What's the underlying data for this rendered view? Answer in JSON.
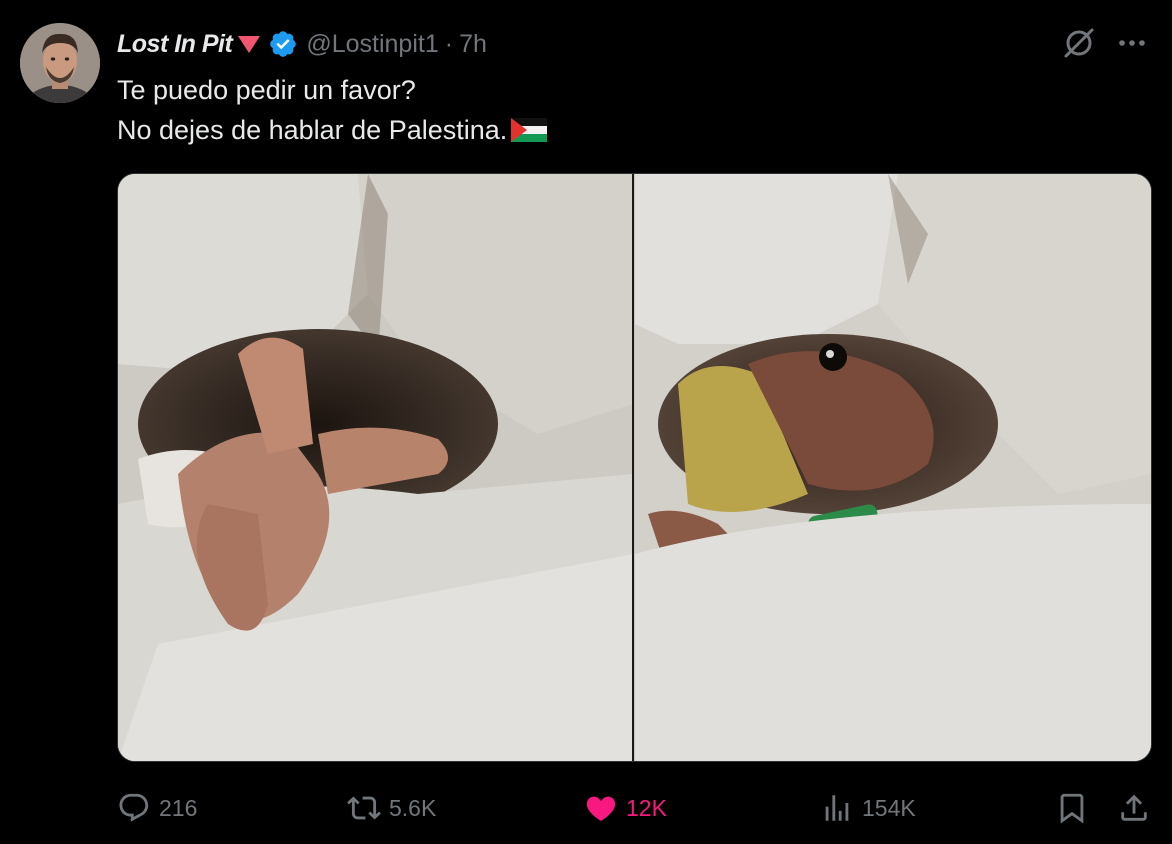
{
  "tweet": {
    "author_name": "Lost In Pit",
    "handle": "@Lostinpit1",
    "separator": "·",
    "time": "7h",
    "text_line1": "Te puedo pedir un favor?",
    "text_line2": "No dejes de hablar de Palestina.",
    "icons": {
      "badge": "pink-triangle-icon",
      "verified": "verified-badge-icon",
      "grok": "grok-icon",
      "more": "more-icon",
      "flag": "palestine-flag-emoji"
    }
  },
  "media": {
    "description_panels": 2
  },
  "actions": {
    "replies": "216",
    "reposts": "5.6K",
    "likes": "12K",
    "views": "154K",
    "icons": [
      "reply-icon",
      "repost-icon",
      "like-icon",
      "views-icon",
      "bookmark-icon",
      "share-icon"
    ]
  },
  "colors": {
    "background": "#000000",
    "text": "#e7e9ea",
    "muted": "#71767b",
    "like": "#f91880",
    "verified": "#1d9bf0"
  }
}
